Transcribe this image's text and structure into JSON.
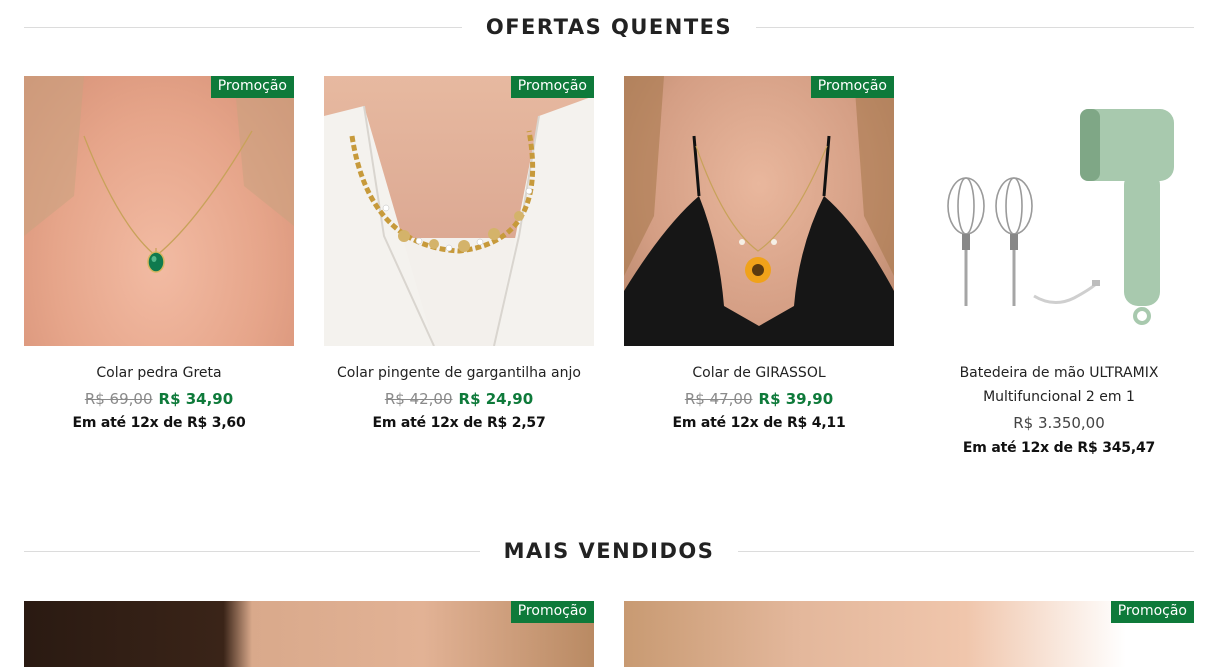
{
  "sections": {
    "hot": {
      "title": "OFERTAS QUENTES"
    },
    "best": {
      "title": "MAIS VENDIDOS"
    }
  },
  "badge_label": "Promoção",
  "products": [
    {
      "name": "Colar pedra Greta",
      "old_price": "R$ 69,00",
      "price": "R$ 34,90",
      "installments": "Em até 12x de R$ 3,60"
    },
    {
      "name": "Colar pingente de gargantilha anjo",
      "old_price": "R$ 42,00",
      "price": "R$ 24,90",
      "installments": "Em até 12x de R$ 2,57"
    },
    {
      "name": "Colar de GIRASSOL",
      "old_price": "R$ 47,00",
      "price": "R$ 39,90",
      "installments": "Em até 12x de R$ 4,11"
    },
    {
      "name_line1": "Batedeira de mão ULTRAMIX",
      "name_line2": "Multifuncional 2 em 1",
      "price": "R$ 3.350,00",
      "installments": "Em até 12x de R$ 345,47"
    }
  ],
  "colors": {
    "accent": "#0e7a3a",
    "old_price": "#8a8a8a"
  }
}
